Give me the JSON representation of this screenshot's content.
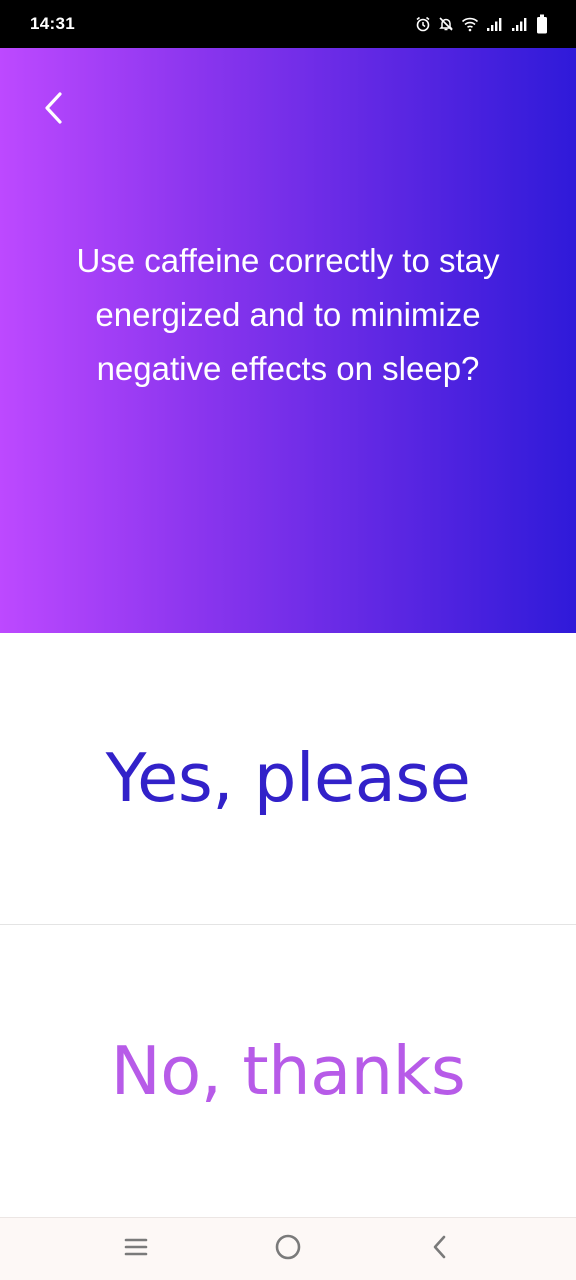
{
  "status_bar": {
    "time": "14:31",
    "icons": [
      "alarm-icon",
      "notifications-off-icon",
      "wifi-icon",
      "signal-icon",
      "signal-icon",
      "battery-icon"
    ]
  },
  "header": {
    "back_icon": "chevron-left-icon",
    "question": "Use caffeine correctly to stay energized and to minimize negative effects on sleep?",
    "gradient_colors": [
      "#bd49ff",
      "#2f1ad9"
    ]
  },
  "choices": {
    "yes_label": "Yes, please",
    "no_label": "No, thanks",
    "yes_color": "#3221c9",
    "no_color": "#b75be8"
  },
  "nav_bar": {
    "icons": [
      "recent-apps-icon",
      "home-icon",
      "back-icon"
    ]
  }
}
